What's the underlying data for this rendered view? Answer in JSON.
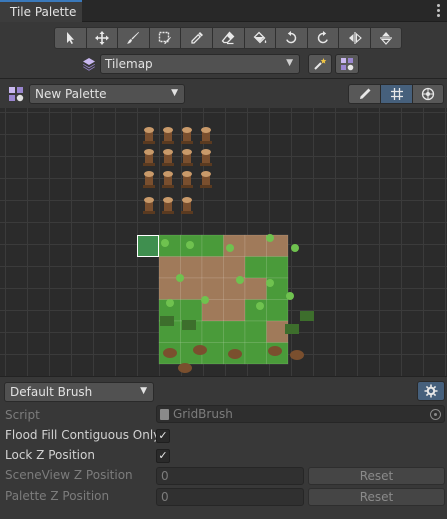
{
  "window": {
    "tab_title": "Tile Palette"
  },
  "toolbar": {
    "tools": [
      {
        "icon": "select-icon"
      },
      {
        "icon": "move-icon"
      },
      {
        "icon": "paint-brush-icon"
      },
      {
        "icon": "box-fill-icon"
      },
      {
        "icon": "picker-icon"
      },
      {
        "icon": "eraser-icon"
      },
      {
        "icon": "fill-bucket-icon"
      },
      {
        "icon": "rotate-ccw-icon"
      },
      {
        "icon": "rotate-cw-icon"
      },
      {
        "icon": "flip-x-icon"
      },
      {
        "icon": "flip-y-icon"
      }
    ],
    "active_target": "Tilemap"
  },
  "palette": {
    "selected": "New Palette",
    "modes": [
      {
        "icon": "pencil-icon",
        "active": false
      },
      {
        "icon": "grid-icon",
        "active": true
      },
      {
        "icon": "gizmo-icon",
        "active": false
      }
    ]
  },
  "brush": {
    "selected": "Default Brush",
    "script_label": "Script",
    "script_value": "GridBrush",
    "flood_fill_label": "Flood Fill Contiguous Only",
    "flood_fill_checked": true,
    "lock_z_label": "Lock Z Position",
    "lock_z_checked": true,
    "sceneview_z_label": "SceneView Z Position",
    "sceneview_z_value": "0",
    "palette_z_label": "Palette Z Position",
    "palette_z_value": "0",
    "reset_label": "Reset",
    "check_glyph": "✓"
  },
  "colors": {
    "accent": "#46607c",
    "grass": "#4a9b3a",
    "dirt": "#a07a5a",
    "bark": "#7a4f2e"
  }
}
